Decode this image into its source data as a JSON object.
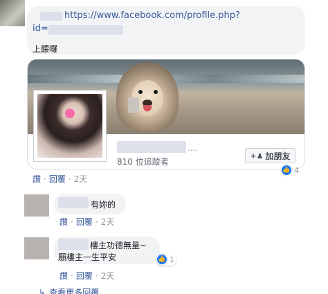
{
  "post_comment": {
    "url_text": "https://www.facebook.com/profile.php?",
    "id_label": "id=",
    "body": "上餵囉",
    "link_card": {
      "followers": "810 位追蹤者",
      "add_friend_label": "加朋友",
      "name_suffix": "...."
    },
    "reaction_count": "4",
    "actions": {
      "like": "讚",
      "reply": "回覆",
      "time": "2天"
    }
  },
  "replies": [
    {
      "text": "有妳的",
      "actions": {
        "like": "讚",
        "reply": "回覆",
        "time": "2天"
      }
    },
    {
      "text_line1": "樓主功德無量~",
      "text_line2": "願樓主一生平安",
      "reaction_count": "1",
      "actions": {
        "like": "讚",
        "reply": "回覆",
        "time": "2天"
      }
    }
  ],
  "more_replies_label": "查看更多回覆",
  "colors": {
    "link": "#365899",
    "bubble": "#f2f3f5",
    "like_badge": "#1877f2"
  },
  "icons": {
    "like": "thumbs-up-icon",
    "add_friend": "add-friend-icon",
    "more_replies": "reply-arrow-icon"
  }
}
